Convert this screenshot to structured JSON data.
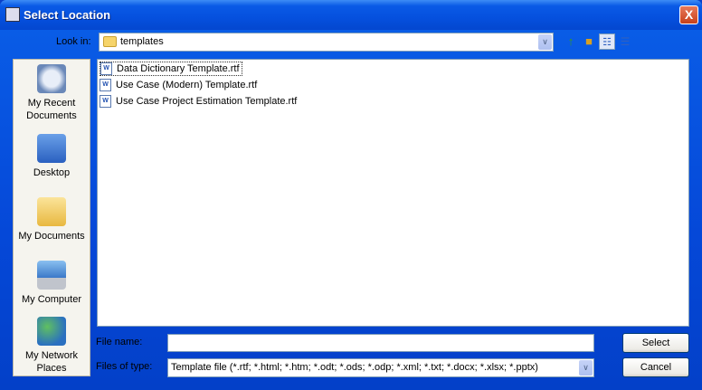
{
  "window": {
    "title": "Select Location",
    "close": "X"
  },
  "look_in": {
    "label": "Look in:",
    "value": "templates"
  },
  "toolbar": [
    "up-one-level",
    "create-new-folder",
    "list-view",
    "details-view"
  ],
  "sidebar": {
    "items": [
      {
        "label": "My Recent Documents",
        "icon": "recent-documents-icon"
      },
      {
        "label": "Desktop",
        "icon": "desktop-icon"
      },
      {
        "label": "My Documents",
        "icon": "my-documents-icon"
      },
      {
        "label": "My Computer",
        "icon": "my-computer-icon"
      },
      {
        "label": "My Network Places",
        "icon": "network-places-icon"
      }
    ]
  },
  "files": [
    "Data Dictionary Template.rtf",
    "Use Case (Modern) Template.rtf",
    "Use Case Project Estimation Template.rtf"
  ],
  "file_name": {
    "label": "File name:",
    "value": ""
  },
  "file_type": {
    "label": "Files of type:",
    "value": "Template file (*.rtf; *.html; *.htm; *.odt; *.ods; *.odp; *.xml; *.txt; *.docx; *.xlsx; *.pptx)"
  },
  "buttons": {
    "select": "Select",
    "cancel": "Cancel"
  }
}
